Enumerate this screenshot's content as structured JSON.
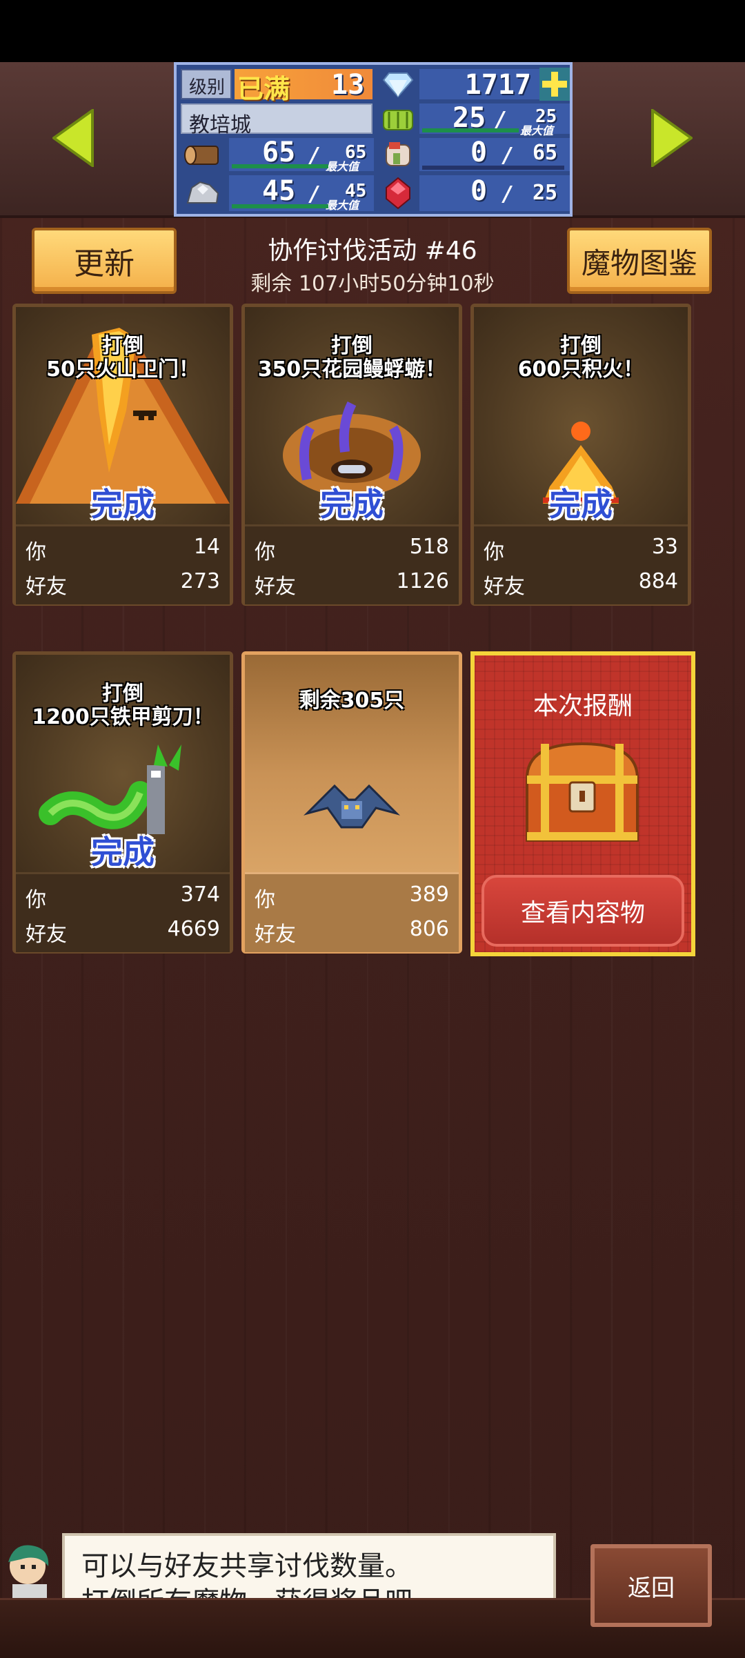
{
  "header": {
    "level_label": "级别",
    "level_badge": "已满",
    "level_value": "13",
    "gems": "1717",
    "town_name": "教培城",
    "resources": [
      {
        "name": "grass",
        "value": "25",
        "max": "25",
        "max_label": "最大值"
      },
      {
        "name": "wood",
        "value": "65",
        "max": "65",
        "max_label": "最大值"
      },
      {
        "name": "meat",
        "value": "0",
        "max": "65"
      },
      {
        "name": "ore",
        "value": "45",
        "max": "45",
        "max_label": "最大值"
      },
      {
        "name": "gem-red",
        "value": "0",
        "max": "25"
      }
    ]
  },
  "event": {
    "refresh_label": "更新",
    "title": "协作讨伐活动 #46",
    "remaining": "剩余 107小时50分钟10秒",
    "bestiary_label": "魔物图鉴"
  },
  "cards": [
    {
      "line1": "打倒",
      "line2": "50只火山卫门！",
      "status": "完成",
      "you_label": "你",
      "you": "14",
      "friends_label": "好友",
      "friends": "273"
    },
    {
      "line1": "打倒",
      "line2": "350只花园鳗蜉蝣！",
      "status": "完成",
      "you_label": "你",
      "you": "518",
      "friends_label": "好友",
      "friends": "1126"
    },
    {
      "line1": "打倒",
      "line2": "600只积火！",
      "status": "完成",
      "you_label": "你",
      "you": "33",
      "friends_label": "好友",
      "friends": "884"
    },
    {
      "line1": "打倒",
      "line2": "1200只铁甲剪刀！",
      "status": "完成",
      "you_label": "你",
      "you": "374",
      "friends_label": "好友",
      "friends": "4669"
    },
    {
      "line1": "剩余305只",
      "line2": "",
      "status": "",
      "you_label": "你",
      "you": "389",
      "friends_label": "好友",
      "friends": "806"
    }
  ],
  "reward": {
    "title": "本次报酬",
    "button": "查看内容物"
  },
  "dialog": {
    "line1": "可以与好友共享讨伐数量。",
    "line2": "打倒所有魔物，获得奖品吧。"
  },
  "back_label": "返回",
  "colors": {
    "panel_blue": "#2f4a8a",
    "gold_button": "#f4b04a",
    "done_blue": "#2f4fd4",
    "reward_red": "#c0342a"
  }
}
